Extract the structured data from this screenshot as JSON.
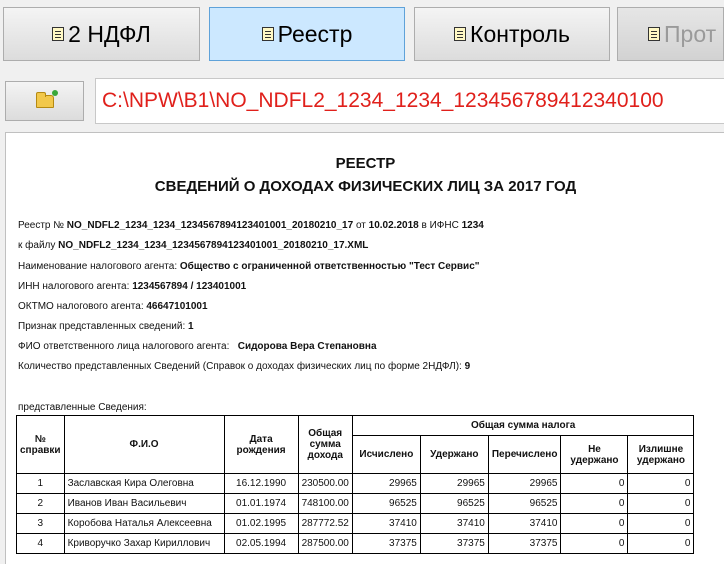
{
  "tabs": [
    {
      "label": "2 НДФЛ"
    },
    {
      "label": "Реестр"
    },
    {
      "label": "Контроль"
    },
    {
      "label": "Прот"
    }
  ],
  "path": {
    "value": "C:\\NPW\\B1\\NO_NDFL2_1234_1234_123456789412340100"
  },
  "report": {
    "title1": "РЕЕСТР",
    "title2": "СВЕДЕНИЙ О ДОХОДАХ ФИЗИЧЕСКИХ ЛИЦ ЗА 2017 ГОД",
    "reg_prefix": "Реестр №",
    "reg_num": "NO_NDFL2_1234_1234_1234567894123401001_20180210_17",
    "reg_from": "от",
    "reg_date": "10.02.2018",
    "reg_ifns": "в ИФНС",
    "ifns_code": "1234",
    "file_label": "к файлу",
    "file_name": "NO_NDFL2_1234_1234_1234567894123401001_20180210_17.XML",
    "agent_label": "Наименование налогового агента:",
    "agent_value": "Общество с ограниченной ответственностью \"Тест Сервис\"",
    "inn_label": "ИНН налогового агента:",
    "inn_value": "1234567894 / 123401001",
    "oktmo_label": "ОКТМО налогового агента:",
    "oktmo_value": "46647101001",
    "sign_label": "Признак представленных сведений:",
    "sign_value": "1",
    "resp_label": "ФИО ответственного лица налогового агента:",
    "resp_value": "Сидорова Вера Степановна",
    "count_label": "Количество представленных Сведений (Справок о доходах физических лиц по форме 2НДФЛ):",
    "count_value": "9",
    "table_caption": "представленные Сведения:",
    "headers": {
      "num": "№ справки",
      "fio": "Ф.И.О",
      "dob": "Дата рождения",
      "income": "Общая сумма дохода",
      "tax_total": "Общая сумма налога",
      "calc": "Исчислено",
      "withheld": "Удержано",
      "transferred": "Перечислено",
      "not_withheld": "Не удержано",
      "excess": "Излишне удержано"
    },
    "rows": [
      {
        "num": "1",
        "fio": "Заславская Кира Олеговна",
        "dob": "16.12.1990",
        "income": "230500.00",
        "calc": "29965",
        "withheld": "29965",
        "transferred": "29965",
        "not_withheld": "0",
        "excess": "0"
      },
      {
        "num": "2",
        "fio": "Иванов Иван Васильевич",
        "dob": "01.01.1974",
        "income": "748100.00",
        "calc": "96525",
        "withheld": "96525",
        "transferred": "96525",
        "not_withheld": "0",
        "excess": "0"
      },
      {
        "num": "3",
        "fio": "Коробова Наталья Алексеевна",
        "dob": "01.02.1995",
        "income": "287772.52",
        "calc": "37410",
        "withheld": "37410",
        "transferred": "37410",
        "not_withheld": "0",
        "excess": "0"
      },
      {
        "num": "4",
        "fio": "Криворучко Захар Кириллович",
        "dob": "02.05.1994",
        "income": "287500.00",
        "calc": "37375",
        "withheld": "37375",
        "transferred": "37375",
        "not_withheld": "0",
        "excess": "0"
      }
    ]
  }
}
